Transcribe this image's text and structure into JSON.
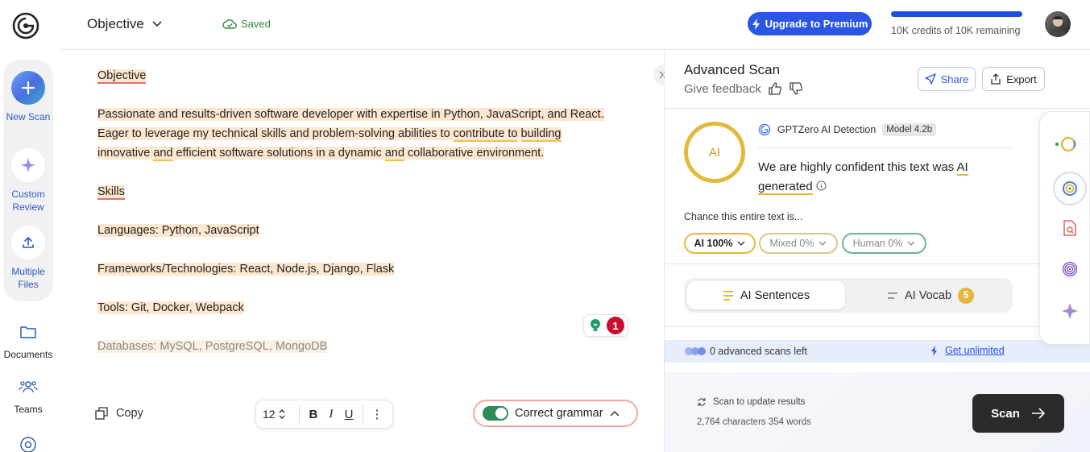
{
  "sidebar": {
    "new_scan": "New Scan",
    "custom_review": "Custom Review",
    "multiple_files": "Multiple Files",
    "documents": "Documents",
    "teams": "Teams"
  },
  "topbar": {
    "doc_title": "Objective",
    "saved": "Saved",
    "upgrade": "Upgrade to Premium",
    "credits_text": "10K credits of 10K remaining",
    "credits_fraction": 1.0
  },
  "editor": {
    "heading_objective": "Objective",
    "para1_a": "Passionate and results-driven software developer with expertise in Python, JavaScript, and React.",
    "para1_b": " Eager to leverage my technical skills and problem-solving abilities to ",
    "para1_c": "contribute to",
    "para1_d": " ",
    "para1_e": "building",
    "para1_f": " innovative ",
    "para1_g": "and",
    "para1_h": " efficient software solutions in a dynamic ",
    "para1_i": "and",
    "para1_j": " collaborative environment.",
    "heading_skills": "Skills",
    "languages": "Languages: Python, JavaScript",
    "frameworks": "Frameworks/Technologies: React, Node.js, Django, Flask",
    "tools": "Tools: Git, Docker, Webpack",
    "databases": "Databases: MySQL, PostgreSQL, MongoDB",
    "suggestion_count": "1"
  },
  "toolbar": {
    "copy": "Copy",
    "font_size": "12",
    "bold": "B",
    "italic": "I",
    "underline": "U",
    "more": "⋮",
    "grammar": "Correct grammar"
  },
  "panel": {
    "title": "Advanced Scan",
    "feedback": "Give feedback",
    "share": "Share",
    "export": "Export",
    "ring_label": "AI",
    "detector": "GPTZero AI Detection",
    "model": "Model 4.2b",
    "confident_a": "We are ",
    "confident_b": "highly confident",
    "confident_c": " this text was ",
    "confident_d": "AI generated",
    "chance": "Chance this entire text is...",
    "chip_ai": "AI 100%",
    "chip_mixed": "Mixed 0%",
    "chip_human": "Human 0%",
    "tab_sentences": "AI Sentences",
    "tab_vocab": "AI Vocab",
    "vocab_count": "5",
    "scans_left": "0 advanced scans left",
    "get_unlimited": "Get unlimited",
    "update_results": "Scan to update results",
    "char_count": "2,764 characters 354 words",
    "scan_button": "Scan"
  },
  "colors": {
    "accent_blue": "#2a55e5",
    "ai_gold": "#e2b93b",
    "highlight": "#fde7cf",
    "human_green": "#6db39b"
  }
}
